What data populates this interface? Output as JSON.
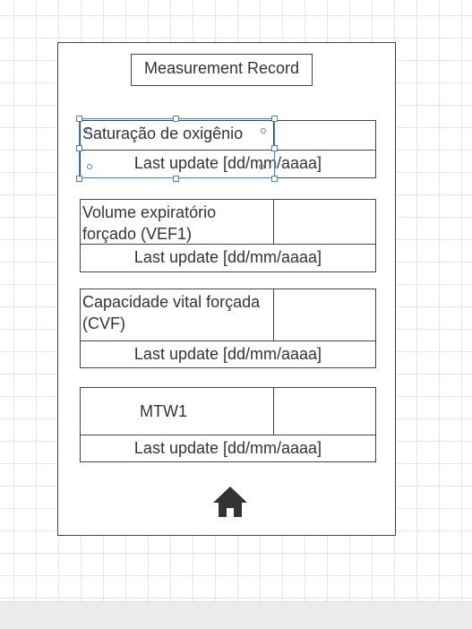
{
  "screen": {
    "title": "Measurement Record",
    "records": [
      {
        "label": "Saturação de oxigênio",
        "value": "",
        "update": "Last update [dd/mm/aaaa]"
      },
      {
        "label": "Volume expiratório forçado (VEF1)",
        "value": "",
        "update": "Last update [dd/mm/aaaa]"
      },
      {
        "label": "Capacidade vital forçada (CVF)",
        "value": "",
        "update": "Last update [dd/mm/aaaa]"
      },
      {
        "label": "MTW1",
        "value": "",
        "update": "Last update [dd/mm/aaaa]"
      }
    ],
    "home_icon": "home-icon"
  },
  "colors": {
    "border": "#444444",
    "text": "#333333",
    "selection": "#4a7fd6",
    "grid": "#e6e6e6"
  }
}
